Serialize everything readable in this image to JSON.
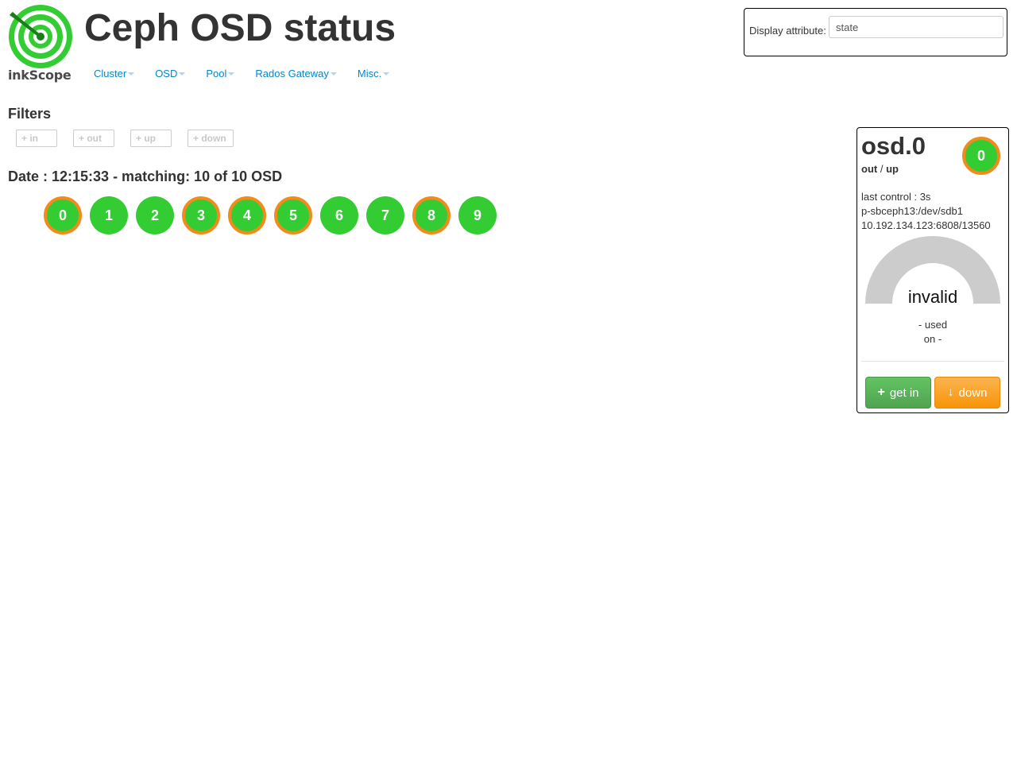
{
  "logo": {
    "text": "inkScope"
  },
  "header": {
    "title": "Ceph OSD status"
  },
  "nav": {
    "items": [
      {
        "label": "Cluster"
      },
      {
        "label": "OSD"
      },
      {
        "label": "Pool"
      },
      {
        "label": "Rados Gateway"
      },
      {
        "label": "Misc."
      }
    ]
  },
  "display_attribute": {
    "label": "Display attribute:",
    "value": "state"
  },
  "filters": {
    "title": "Filters",
    "buttons": [
      {
        "label": "+ in"
      },
      {
        "label": "+ out"
      },
      {
        "label": "+ up"
      },
      {
        "label": "+ down"
      }
    ]
  },
  "status_line": "Date : 12:15:33 - matching: 10 of 10 OSD",
  "osds": [
    {
      "label": "0",
      "orange_ring": true
    },
    {
      "label": "1",
      "orange_ring": false
    },
    {
      "label": "2",
      "orange_ring": false
    },
    {
      "label": "3",
      "orange_ring": true
    },
    {
      "label": "4",
      "orange_ring": true
    },
    {
      "label": "5",
      "orange_ring": true
    },
    {
      "label": "6",
      "orange_ring": false
    },
    {
      "label": "7",
      "orange_ring": false
    },
    {
      "label": "8",
      "orange_ring": true
    },
    {
      "label": "9",
      "orange_ring": false
    }
  ],
  "detail": {
    "name": "osd.0",
    "state_in": "out",
    "state_sep": "/",
    "state_up": "up",
    "badge": "0",
    "last_control": "last control : 3s",
    "device": "p-sbceph13:/dev/sdb1",
    "address": "10.192.134.123:6808/13560",
    "gauge_label": "invalid",
    "used": "- used",
    "on": "on -",
    "get_in_label": "get in",
    "down_label": "down"
  },
  "colors": {
    "osd_green": "#33cc33",
    "ring_orange": "#f08b1c",
    "link_blue": "#0088cc",
    "gauge_gray": "#cccccc",
    "success": "#51a351",
    "warning": "#f89406"
  }
}
